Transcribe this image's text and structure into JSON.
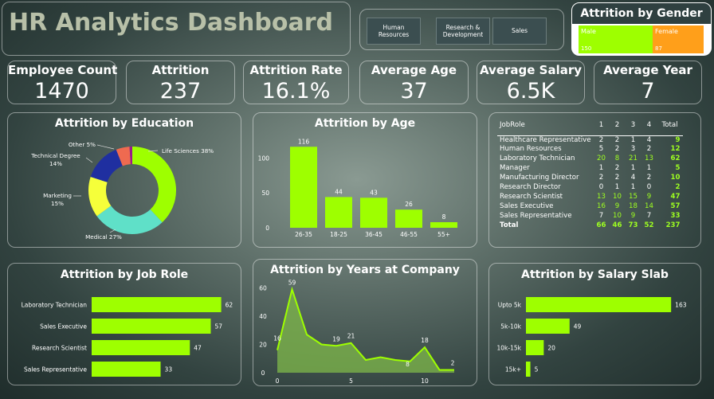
{
  "header": {
    "title": "HR Analytics Dashboard",
    "departments": [
      "Human\nResources",
      "Research &\nDevelopment",
      "Sales"
    ]
  },
  "gender": {
    "title": "Attrition by Gender",
    "male_label": "Male",
    "male_value": "150",
    "female_label": "Female",
    "female_value": "87"
  },
  "kpis": [
    {
      "label": "Employee Count",
      "value": "1470"
    },
    {
      "label": "Attrition",
      "value": "237"
    },
    {
      "label": "Attrition Rate",
      "value": "16.1%"
    },
    {
      "label": "Average Age",
      "value": "37"
    },
    {
      "label": "Average Salary",
      "value": "6.5K"
    },
    {
      "label": "Average Year",
      "value": "7"
    }
  ],
  "colors": {
    "green": "#9eff00",
    "orange": "#ff9f1a",
    "teal": "#5fe0c8",
    "yellow": "#f5ff3a",
    "blue": "#1f2fa0",
    "coral": "#ef6a50",
    "purple": "#9a1a8a"
  },
  "chart_data": [
    {
      "type": "pie",
      "title": "Attrition by Education",
      "labels": [
        "Life Sciences 38%",
        "Medical 27%",
        "Marketing\n15%",
        "Technical Degree\n14%",
        "Other 5%",
        ""
      ],
      "values": [
        38,
        27,
        15,
        14,
        5,
        1
      ],
      "colors": [
        "#9eff00",
        "#5fe0c8",
        "#f5ff3a",
        "#1f2fa0",
        "#ef6a50",
        "#9a1a8a"
      ]
    },
    {
      "type": "bar",
      "title": "Attrition by Age",
      "categories": [
        "26-35",
        "18-25",
        "36-45",
        "46-55",
        "55+"
      ],
      "values": [
        116,
        44,
        43,
        26,
        8
      ],
      "yticks": [
        0,
        50,
        100
      ],
      "ylim": [
        0,
        130
      ]
    },
    {
      "type": "table",
      "header": [
        "JobRole",
        "1",
        "2",
        "3",
        "4",
        "Total"
      ],
      "rows": [
        [
          "Healthcare Representative",
          "2",
          "2",
          "1",
          "4",
          "9"
        ],
        [
          "Human Resources",
          "5",
          "2",
          "3",
          "2",
          "12"
        ],
        [
          "Laboratory Technician",
          "20",
          "8",
          "21",
          "13",
          "62"
        ],
        [
          "Manager",
          "1",
          "2",
          "1",
          "1",
          "5"
        ],
        [
          "Manufacturing Director",
          "2",
          "2",
          "4",
          "2",
          "10"
        ],
        [
          "Research Director",
          "0",
          "1",
          "1",
          "0",
          "2"
        ],
        [
          "Research Scientist",
          "13",
          "10",
          "15",
          "9",
          "47"
        ],
        [
          "Sales Executive",
          "16",
          "9",
          "18",
          "14",
          "57"
        ],
        [
          "Sales Representative",
          "7",
          "10",
          "9",
          "7",
          "33"
        ]
      ],
      "total": [
        "Total",
        "66",
        "46",
        "73",
        "52",
        "237"
      ]
    },
    {
      "type": "bar",
      "title": "Attrition by Job Role",
      "categories": [
        "Laboratory Technician",
        "Sales Executive",
        "Research Scientist",
        "Sales Representative"
      ],
      "values": [
        62,
        57,
        47,
        33
      ],
      "xlim": [
        0,
        70
      ]
    },
    {
      "type": "area",
      "title": "Attrition by Years at Company",
      "x": [
        0,
        1,
        2,
        3,
        4,
        5,
        6,
        7,
        8,
        9,
        10,
        11,
        12
      ],
      "values": [
        16,
        59,
        27,
        20,
        19,
        21,
        9,
        11,
        9,
        8,
        18,
        2,
        2
      ],
      "point_labels": {
        "0": "16",
        "1": "59",
        "4": "19",
        "5": "21",
        "9": "8",
        "10": "18",
        "12": "2"
      },
      "xticks": [
        0,
        5,
        10
      ],
      "yticks": [
        0,
        20,
        40,
        60
      ],
      "ylim": [
        0,
        62
      ],
      "xlim": [
        0,
        12
      ]
    },
    {
      "type": "bar",
      "title": "Attrition by Salary Slab",
      "categories": [
        "Upto 5k",
        "5k-10k",
        "10k-15k",
        "15k+"
      ],
      "values": [
        163,
        49,
        20,
        5
      ],
      "xlim": [
        0,
        170
      ]
    }
  ]
}
